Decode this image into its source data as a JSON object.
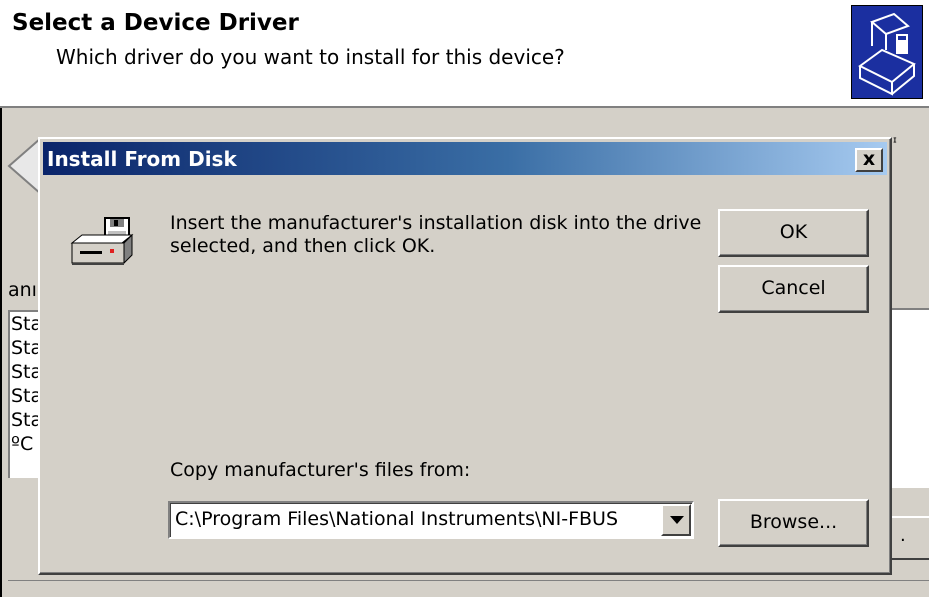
{
  "wizard": {
    "title": "Select a Device Driver",
    "subtitle": "Which driver do you want to install for this device?",
    "fragments": {
      "manufacturer_cut": "anı",
      "right_cut": "ᶦ",
      "list_items": [
        "Sta",
        "Sta",
        "Sta",
        "Sta",
        "Sta",
        "ºC"
      ],
      "right_button_dot": "."
    },
    "icon": "hardware-wizard-icon"
  },
  "dialog": {
    "title": "Install From Disk",
    "close_label": "x",
    "message": "Insert the manufacturer's installation disk into the drive selected, and then click OK.",
    "ok_label": "OK",
    "cancel_label": "Cancel",
    "copy_label": "Copy manufacturer's files from:",
    "path_value": "C:\\Program Files\\National Instruments\\NI-FBUS",
    "browse_label": "Browse...",
    "icon": "floppy-disk-drive-icon",
    "colors": {
      "titlebar_start": "#0a246a",
      "titlebar_end": "#a6caf0",
      "face": "#d4d0c8"
    }
  }
}
